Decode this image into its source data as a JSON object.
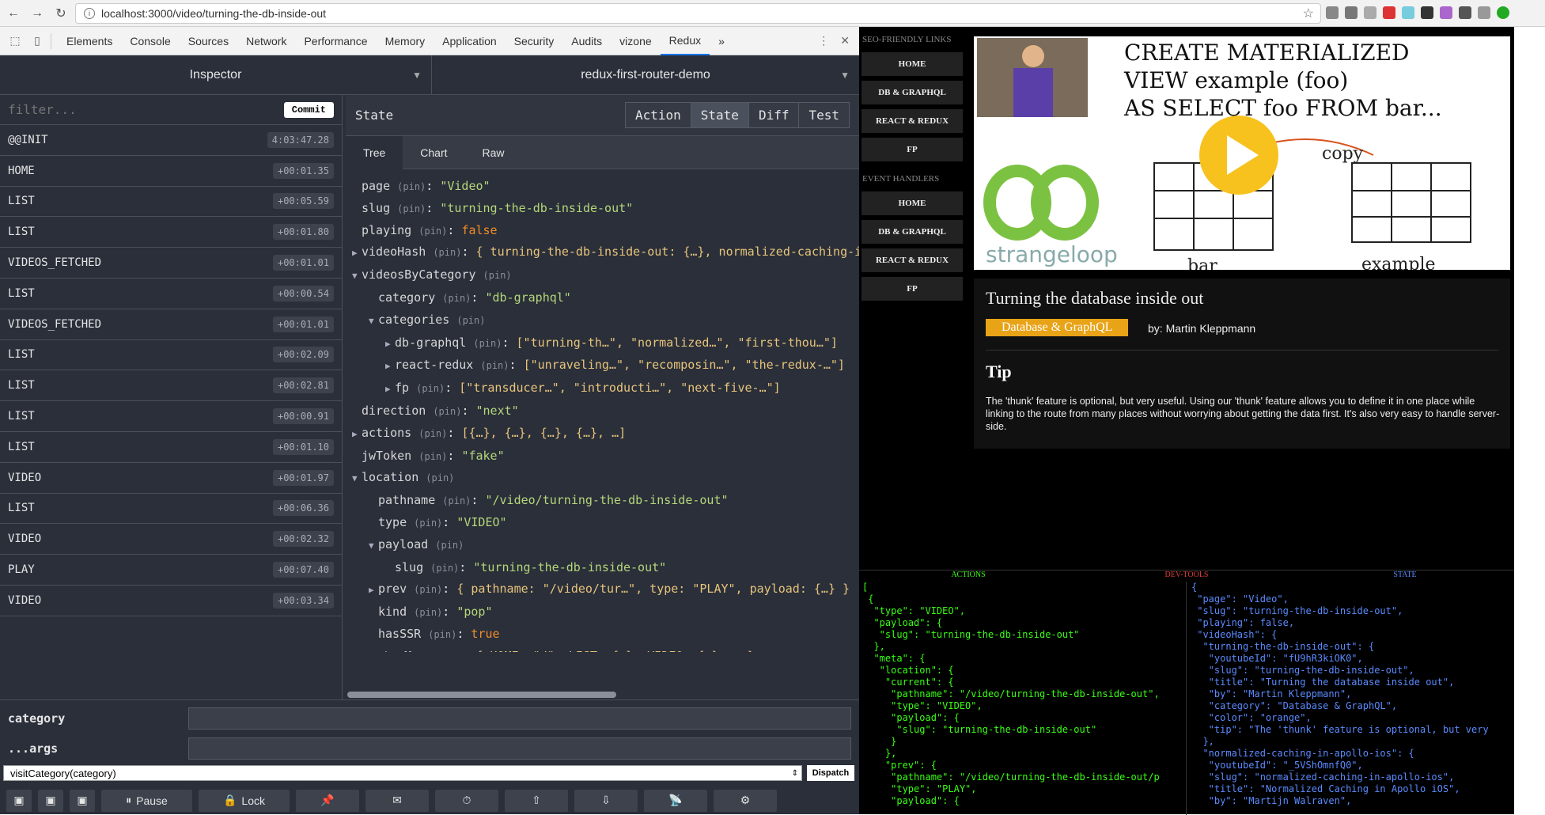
{
  "browser": {
    "url": "localhost:3000/video/turning-the-db-inside-out"
  },
  "devtools": {
    "tabs": [
      "Elements",
      "Console",
      "Sources",
      "Network",
      "Performance",
      "Memory",
      "Application",
      "Security",
      "Audits",
      "vizone",
      "Redux"
    ],
    "active_tab": "Redux"
  },
  "redux": {
    "monitor": "Inspector",
    "instance": "redux-first-router-demo",
    "filter_placeholder": "filter...",
    "commit_label": "Commit",
    "actions": [
      {
        "name": "@@INIT",
        "time": "4:03:47.28"
      },
      {
        "name": "HOME",
        "time": "+00:01.35"
      },
      {
        "name": "LIST",
        "time": "+00:05.59"
      },
      {
        "name": "LIST",
        "time": "+00:01.80"
      },
      {
        "name": "VIDEOS_FETCHED",
        "time": "+00:01.01"
      },
      {
        "name": "LIST",
        "time": "+00:00.54"
      },
      {
        "name": "VIDEOS_FETCHED",
        "time": "+00:01.01"
      },
      {
        "name": "LIST",
        "time": "+00:02.09"
      },
      {
        "name": "LIST",
        "time": "+00:02.81"
      },
      {
        "name": "LIST",
        "time": "+00:00.91"
      },
      {
        "name": "LIST",
        "time": "+00:01.10"
      },
      {
        "name": "VIDEO",
        "time": "+00:01.97"
      },
      {
        "name": "LIST",
        "time": "+00:06.36"
      },
      {
        "name": "VIDEO",
        "time": "+00:02.32"
      },
      {
        "name": "PLAY",
        "time": "+00:07.40"
      },
      {
        "name": "VIDEO",
        "time": "+00:03.34"
      }
    ],
    "state_title": "State",
    "state_buttons": [
      "Action",
      "State",
      "Diff",
      "Test"
    ],
    "active_state_button": "State",
    "view_tabs": [
      "Tree",
      "Chart",
      "Raw"
    ],
    "active_view_tab": "Tree",
    "pin": "(pin)",
    "tree": [
      {
        "indent": 0,
        "arrow": "",
        "key": "page",
        "value": "\"Video\"",
        "type": "str"
      },
      {
        "indent": 0,
        "arrow": "",
        "key": "slug",
        "value": "\"turning-the-db-inside-out\"",
        "type": "str"
      },
      {
        "indent": 0,
        "arrow": "",
        "key": "playing",
        "value": "false",
        "type": "bool"
      },
      {
        "indent": 0,
        "arrow": "▶",
        "key": "videoHash",
        "value": "{ turning-the-db-inside-out: {…}, normalized-caching-in",
        "type": "obj"
      },
      {
        "indent": 0,
        "arrow": "▼",
        "key": "videosByCategory",
        "value": "",
        "type": "obj"
      },
      {
        "indent": 1,
        "arrow": "",
        "key": "category",
        "value": "\"db-graphql\"",
        "type": "str"
      },
      {
        "indent": 1,
        "arrow": "▼",
        "key": "categories",
        "value": "",
        "type": "obj"
      },
      {
        "indent": 2,
        "arrow": "▶",
        "key": "db-graphql",
        "value": "[\"turning-th…\", \"normalized…\", \"first-thou…\"]",
        "type": "obj"
      },
      {
        "indent": 2,
        "arrow": "▶",
        "key": "react-redux",
        "value": "[\"unraveling…\", \"recomposin…\", \"the-redux-…\"]",
        "type": "obj"
      },
      {
        "indent": 2,
        "arrow": "▶",
        "key": "fp",
        "value": "[\"transducer…\", \"introducti…\", \"next-five-…\"]",
        "type": "obj"
      },
      {
        "indent": 0,
        "arrow": "",
        "key": "direction",
        "value": "\"next\"",
        "type": "str"
      },
      {
        "indent": 0,
        "arrow": "▶",
        "key": "actions",
        "value": "[{…}, {…}, {…}, {…}, …]",
        "type": "obj"
      },
      {
        "indent": 0,
        "arrow": "",
        "key": "jwToken",
        "value": "\"fake\"",
        "type": "str"
      },
      {
        "indent": 0,
        "arrow": "▼",
        "key": "location",
        "value": "",
        "type": "obj"
      },
      {
        "indent": 1,
        "arrow": "",
        "key": "pathname",
        "value": "\"/video/turning-the-db-inside-out\"",
        "type": "str"
      },
      {
        "indent": 1,
        "arrow": "",
        "key": "type",
        "value": "\"VIDEO\"",
        "type": "str"
      },
      {
        "indent": 1,
        "arrow": "▼",
        "key": "payload",
        "value": "",
        "type": "obj"
      },
      {
        "indent": 2,
        "arrow": "",
        "key": "slug",
        "value": "\"turning-the-db-inside-out\"",
        "type": "str"
      },
      {
        "indent": 1,
        "arrow": "▶",
        "key": "prev",
        "value": "{ pathname: \"/video/tur…\", type: \"PLAY\", payload: {…} }",
        "type": "obj"
      },
      {
        "indent": 1,
        "arrow": "",
        "key": "kind",
        "value": "\"pop\"",
        "type": "str"
      },
      {
        "indent": 1,
        "arrow": "",
        "key": "hasSSR",
        "value": "true",
        "type": "bool"
      },
      {
        "indent": 0,
        "arrow": "▶",
        "key": "routesMap",
        "value": "{ HOME: \"/\", LIST: {…}, VIDEO: {…}, … }",
        "type": "obj"
      }
    ],
    "dispatcher": {
      "field1_label": "category",
      "field2_label": "...args",
      "selected": "visitCategory(category)",
      "dispatch_label": "Dispatch"
    },
    "footer": {
      "pause_label": "Pause",
      "lock_label": "Lock"
    }
  },
  "app": {
    "sections": [
      {
        "title": "SEO-FRIENDLY LINKS",
        "links": [
          "HOME",
          "DB & GRAPHQL",
          "REACT & REDUX",
          "FP"
        ]
      },
      {
        "title": "EVENT HANDLERS",
        "links": [
          "HOME",
          "DB & GRAPHQL",
          "REACT & REDUX",
          "FP"
        ]
      }
    ],
    "video": {
      "title": "Turning the database inside out",
      "category": "Database & GraphQL",
      "byline": "by: Martin Kleppmann",
      "tip_heading": "Tip",
      "tip_text": "The 'thunk' feature is optional, but very useful. Using our 'thunk' feature allows you to define it in one place while linking to the route from many places without worrying about getting the data first. It's also very easy to handle server-side.",
      "thumb_text_line1": "CREATE MATERIALIZED",
      "thumb_text_line2": "VIEW example (foo)",
      "thumb_text_line3": "AS SELECT foo FROM bar...",
      "thumb_copy": "copy",
      "thumb_example": "example",
      "thumb_bar": "bar",
      "thumb_logo": "strangeloop"
    }
  },
  "logger": {
    "headers": [
      "ACTIONS",
      "DEV-TOOLS",
      "STATE"
    ],
    "actions_text": "[\n {\n  \"type\": \"VIDEO\",\n  \"payload\": {\n   \"slug\": \"turning-the-db-inside-out\"\n  },\n  \"meta\": {\n   \"location\": {\n    \"current\": {\n     \"pathname\": \"/video/turning-the-db-inside-out\",\n     \"type\": \"VIDEO\",\n     \"payload\": {\n      \"slug\": \"turning-the-db-inside-out\"\n     }\n    },\n    \"prev\": {\n     \"pathname\": \"/video/turning-the-db-inside-out/p\n     \"type\": \"PLAY\",\n     \"payload\": {",
    "state_text": "{\n \"page\": \"Video\",\n \"slug\": \"turning-the-db-inside-out\",\n \"playing\": false,\n \"videoHash\": {\n  \"turning-the-db-inside-out\": {\n   \"youtubeId\": \"fU9hR3kiOK0\",\n   \"slug\": \"turning-the-db-inside-out\",\n   \"title\": \"Turning the database inside out\",\n   \"by\": \"Martin Kleppmann\",\n   \"category\": \"Database & GraphQL\",\n   \"color\": \"orange\",\n   \"tip\": \"The 'thunk' feature is optional, but very\n  },\n  \"normalized-caching-in-apollo-ios\": {\n   \"youtubeId\": \"_5VShOmnfQ0\",\n   \"slug\": \"normalized-caching-in-apollo-ios\",\n   \"title\": \"Normalized Caching in Apollo iOS\",\n   \"by\": \"Martijn Walraven\","
  }
}
